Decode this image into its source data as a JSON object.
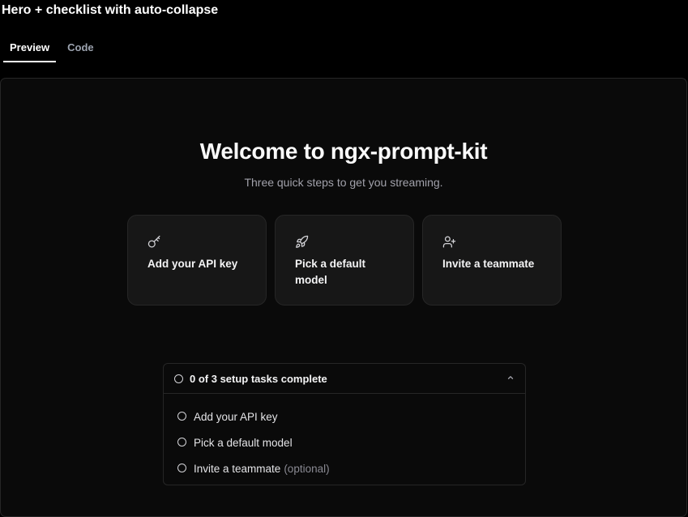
{
  "page": {
    "title": "Hero + checklist with auto-collapse"
  },
  "tabs": [
    {
      "label": "Preview",
      "active": true
    },
    {
      "label": "Code",
      "active": false
    }
  ],
  "hero": {
    "title": "Welcome to ngx-prompt-kit",
    "subtitle": "Three quick steps to get you streaming."
  },
  "cards": [
    {
      "icon": "key-icon",
      "label": "Add your API key"
    },
    {
      "icon": "rocket-icon",
      "label": "Pick a default model"
    },
    {
      "icon": "user-plus-icon",
      "label": "Invite a teammate"
    }
  ],
  "checklist": {
    "header": "0 of 3 setup tasks complete",
    "expanded": true,
    "tasks": [
      {
        "label": "Add your API key",
        "note": "",
        "done": false
      },
      {
        "label": "Pick a default model",
        "note": "",
        "done": false
      },
      {
        "label": "Invite a teammate",
        "note": "(optional)",
        "done": false
      }
    ]
  },
  "colors": {
    "background": "#000000",
    "panel": "#0a0a0a",
    "card": "#171717",
    "border": "#262626",
    "text": "#f4f4f5",
    "muted": "#a1a1aa"
  }
}
